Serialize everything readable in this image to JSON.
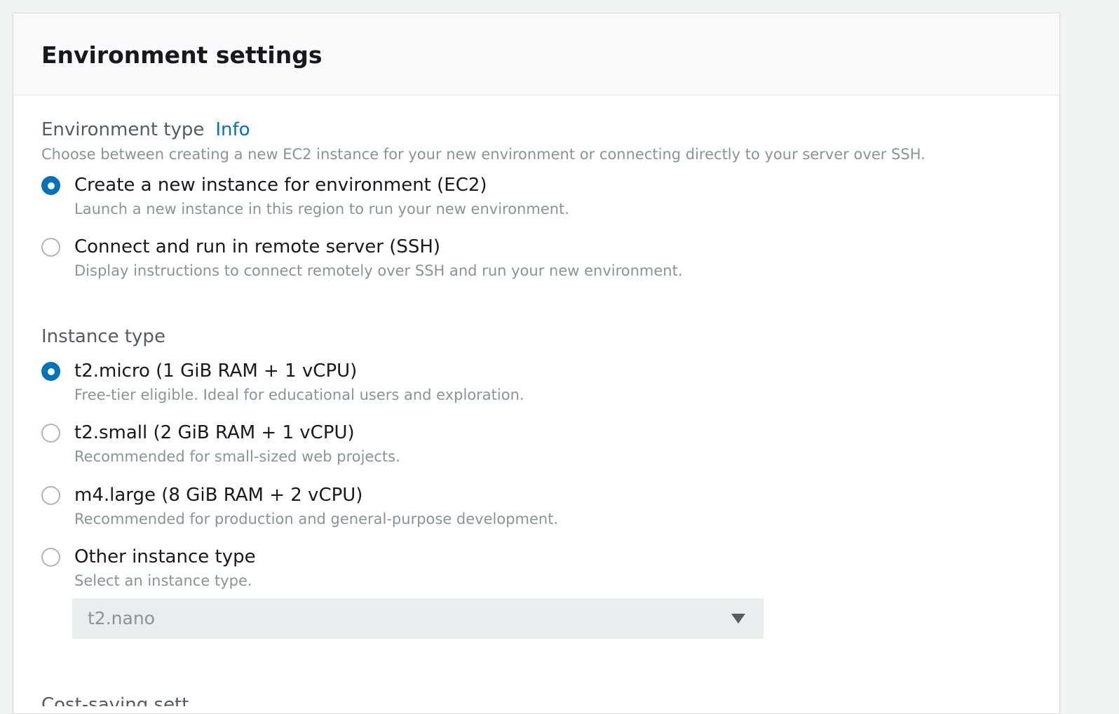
{
  "panel": {
    "title": "Environment settings"
  },
  "environment_type": {
    "label": "Environment type",
    "info_link": "Info",
    "description": "Choose between creating a new EC2 instance for your new environment or connecting directly to your server over SSH.",
    "options": [
      {
        "label": "Create a new instance for environment (EC2)",
        "description": "Launch a new instance in this region to run your new environment.",
        "selected": true
      },
      {
        "label": "Connect and run in remote server (SSH)",
        "description": "Display instructions to connect remotely over SSH and run your new environment.",
        "selected": false
      }
    ]
  },
  "instance_type": {
    "label": "Instance type",
    "options": [
      {
        "label": "t2.micro (1 GiB RAM + 1 vCPU)",
        "description": "Free-tier eligible. Ideal for educational users and exploration.",
        "selected": true
      },
      {
        "label": "t2.small (2 GiB RAM + 1 vCPU)",
        "description": "Recommended for small-sized web projects.",
        "selected": false
      },
      {
        "label": "m4.large (8 GiB RAM + 2 vCPU)",
        "description": "Recommended for production and general-purpose development.",
        "selected": false
      },
      {
        "label": "Other instance type",
        "description": "Select an instance type.",
        "selected": false
      }
    ],
    "other_select": {
      "value": "t2.nano"
    }
  },
  "next_section": {
    "label": "Cost-saving setting"
  },
  "colors": {
    "accent": "#0073bb",
    "text": "#16191f",
    "muted": "#879596"
  }
}
